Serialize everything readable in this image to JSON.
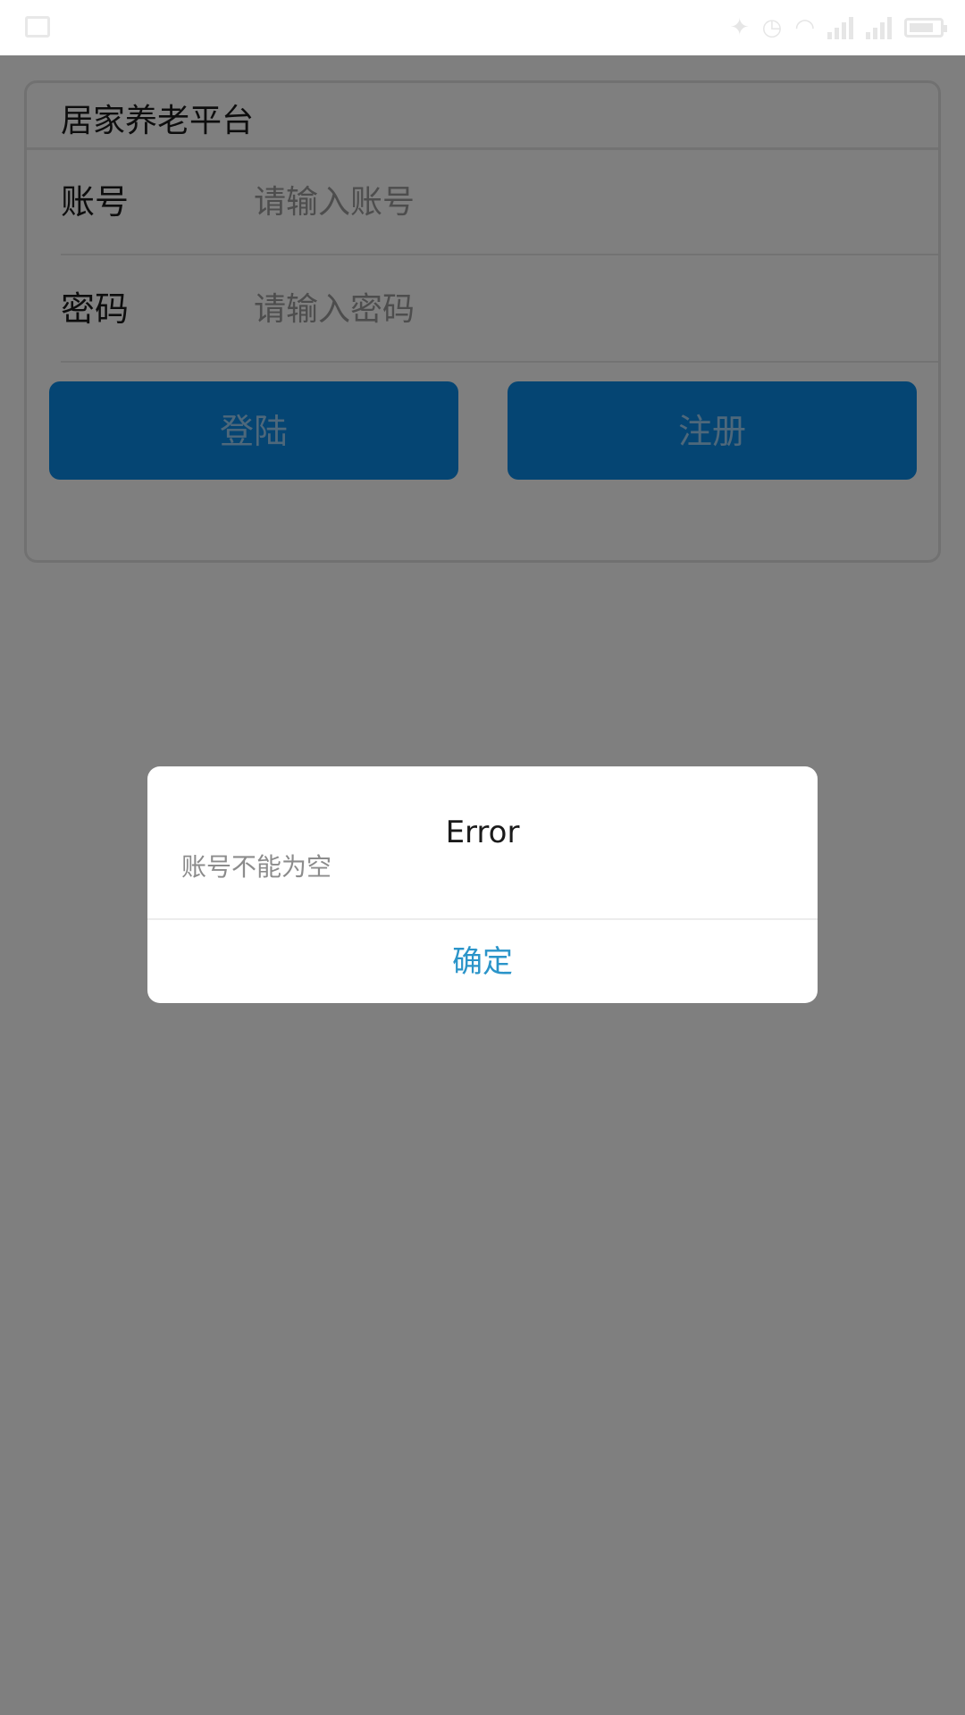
{
  "status_bar": {
    "left_icon": "image-notification-icon",
    "right_text": "",
    "icons": [
      "bluetooth-icon",
      "alarm-icon",
      "wifi-icon",
      "signal-icon",
      "signal-icon",
      "battery-icon"
    ]
  },
  "app": {
    "card_title": "居家养老平台",
    "account": {
      "label": "账号",
      "placeholder": "请输入账号",
      "value": ""
    },
    "password": {
      "label": "密码",
      "placeholder": "请输入密码",
      "value": ""
    },
    "buttons": {
      "login_label": "登陆",
      "register_label": "注册"
    },
    "colors": {
      "primary_button": "#0a8ae6",
      "dialog_action": "#2a94c9"
    }
  },
  "dialog": {
    "title": "Error",
    "message": "账号不能为空",
    "confirm_label": "确定"
  }
}
